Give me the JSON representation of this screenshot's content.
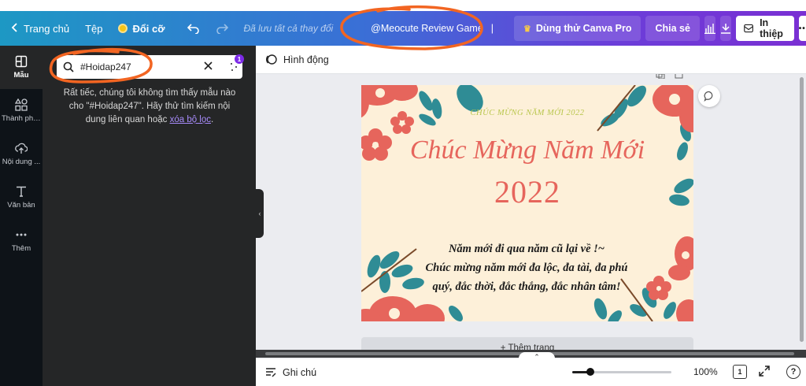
{
  "topbar": {
    "home_label": "Trang chủ",
    "file_label": "Tệp",
    "resize_label": "Đổi cỡ",
    "saved_status": "Đã lưu tất cả thay đổi",
    "doc_title": "@Meocute Review Game",
    "pro_label": "Dùng thử Canva Pro",
    "share_label": "Chia sẻ",
    "print_label": "In thiệp",
    "more_label": "•••"
  },
  "rail": {
    "items": [
      {
        "label": "Mẫu",
        "icon": "templates-icon"
      },
      {
        "label": "Thành phần",
        "icon": "elements-icon"
      },
      {
        "label": "Nội dung ...",
        "icon": "upload-icon"
      },
      {
        "label": "Văn bản",
        "icon": "text-icon"
      },
      {
        "label": "Thêm",
        "icon": "more-icon"
      }
    ]
  },
  "panel": {
    "search_value": "#Hoidap247",
    "filter_count": "1",
    "noresult_text": "Rất tiếc, chúng tôi không tìm thấy mẫu nào cho \"#Hoidap247\". Hãy thử tìm kiếm nội dung liên quan hoặc ",
    "clear_filter_link": "xóa bộ lọc",
    "noresult_end": "."
  },
  "subbar": {
    "animate_label": "Hình động"
  },
  "card": {
    "small_title": "CHÚC MỪNG NĂM MỚI 2022",
    "big_title": "Chúc Mừng Năm Mới",
    "year": "2022",
    "msg_line1": "Năm mới đi qua năm cũ lại về !~",
    "msg_line2": "Chúc mừng năm mới đa lộc, đa tài, đa phú",
    "msg_line3": "quý, đắc thời, đắc thắng, đắc nhân tâm!"
  },
  "canvas": {
    "add_page_label": "+ Thêm trang"
  },
  "bottombar": {
    "notes_label": "Ghi chú",
    "zoom_value": "100%",
    "zoom_fraction": 0.18,
    "page_count": "1"
  },
  "colors": {
    "accent": "#7d2ae8",
    "annotation": "#f26522",
    "card_coral": "#e6655c",
    "card_teal": "#2f8c95"
  }
}
